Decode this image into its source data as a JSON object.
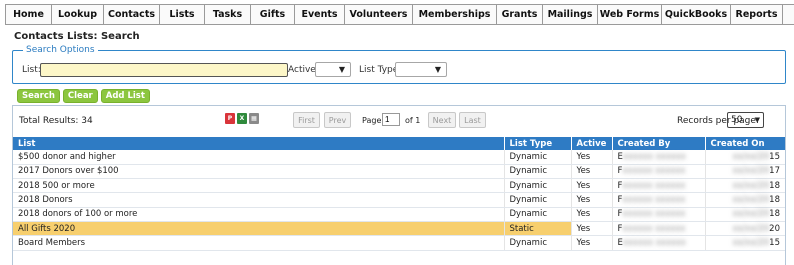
{
  "nav": [
    {
      "label": "Home"
    },
    {
      "label": "Lookup"
    },
    {
      "label": "Contacts"
    },
    {
      "label": "Lists"
    },
    {
      "label": "Tasks"
    },
    {
      "label": "Gifts"
    },
    {
      "label": "Events"
    },
    {
      "label": "Volunteers"
    },
    {
      "label": "Memberships"
    },
    {
      "label": "Grants"
    },
    {
      "label": "Mailings"
    },
    {
      "label": "Web Forms"
    },
    {
      "label": "QuickBooks"
    },
    {
      "label": "Reports"
    }
  ],
  "page_title": "Contacts Lists: Search",
  "search": {
    "legend": "Search Options",
    "list_label": "List:",
    "list_value": "",
    "active_label": "Active:",
    "active_value": "",
    "list_type_label": "List Type:",
    "list_type_value": ""
  },
  "buttons": {
    "search": "Search",
    "clear": "Clear",
    "add_list": "Add List"
  },
  "results": {
    "total": "Total Results: 34",
    "first": "First",
    "prev": "Prev",
    "page_label": "Page",
    "page_value": "1",
    "of_label": "of 1",
    "next": "Next",
    "last": "Last",
    "rpp_label": "Records per page:",
    "rpp_value": "50",
    "export_icons": [
      "pdf-icon",
      "excel-icon",
      "print-icon"
    ]
  },
  "table": {
    "headers": [
      "List",
      "List Type",
      "Active",
      "Created By",
      "Created On"
    ],
    "rows": [
      {
        "list": "$500 donor and higher",
        "type": "Dynamic",
        "active": "Yes",
        "created_by": "E",
        "created_on": "15"
      },
      {
        "list": "2017 Donors over $100",
        "type": "Dynamic",
        "active": "Yes",
        "created_by": "F",
        "created_on": "17"
      },
      {
        "list": "2018 500 or more",
        "type": "Dynamic",
        "active": "Yes",
        "created_by": "F",
        "created_on": "18"
      },
      {
        "list": "2018 Donors",
        "type": "Dynamic",
        "active": "Yes",
        "created_by": "F",
        "created_on": "18"
      },
      {
        "list": "2018 donors of 100 or more",
        "type": "Dynamic",
        "active": "Yes",
        "created_by": "F",
        "created_on": "18"
      },
      {
        "list": "All Gifts 2020",
        "type": "Static",
        "active": "Yes",
        "created_by": "F",
        "created_on": "20"
      },
      {
        "list": "Board Members",
        "type": "Dynamic",
        "active": "Yes",
        "created_by": "E",
        "created_on": "15"
      }
    ]
  },
  "colors": {
    "header_blue": "#2e7bc4",
    "green_button": "#8cc63f",
    "highlight": "#f7cf6e"
  }
}
